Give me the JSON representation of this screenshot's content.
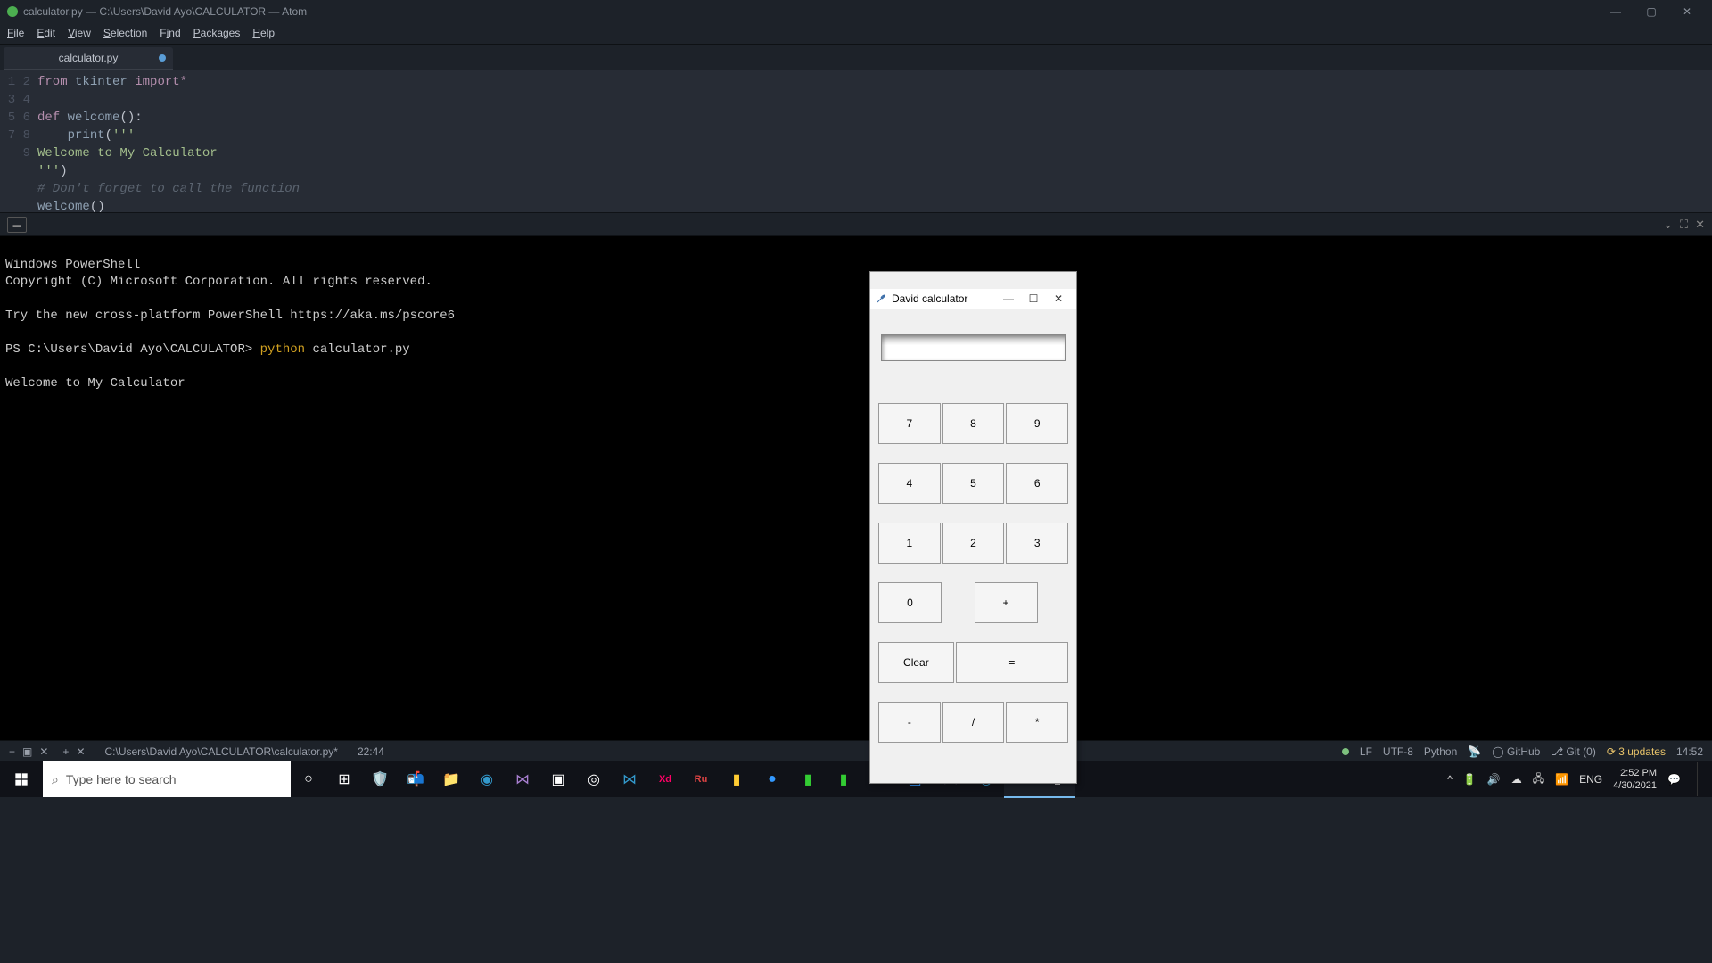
{
  "window": {
    "title": "calculator.py — C:\\Users\\David Ayo\\CALCULATOR — Atom"
  },
  "menu": [
    "File",
    "Edit",
    "View",
    "Selection",
    "Find",
    "Packages",
    "Help"
  ],
  "tab": {
    "name": "calculator.py",
    "modified": true
  },
  "code": {
    "lines": [
      "1",
      "2",
      "3",
      "4",
      "5",
      "6",
      "7",
      "8",
      "9"
    ],
    "l1_kw": "from",
    "l1_mod": "tkinter",
    "l1_kw2": "import",
    "l1_star": "*",
    "l3_kw": "def",
    "l3_fn": "welcome",
    "l3_rest": "():",
    "l4_indent": "    ",
    "l4_fn": "print",
    "l4_open": "(",
    "l4_str": "'''",
    "l5": "Welcome to My Calculator",
    "l6": "''')",
    "l7": "# Don't forget to call the function",
    "l8_fn": "welcome",
    "l8_rest": "()"
  },
  "terminal": {
    "line1": "Windows PowerShell",
    "line2": "Copyright (C) Microsoft Corporation. All rights reserved.",
    "line3": "Try the new cross-platform PowerShell https://aka.ms/pscore6",
    "prompt": "PS C:\\Users\\David Ayo\\CALCULATOR> ",
    "cmd": "python",
    "arg": " calculator.py",
    "out": "Welcome to My Calculator"
  },
  "calc": {
    "title": "David calculator",
    "b7": "7",
    "b8": "8",
    "b9": "9",
    "b4": "4",
    "b5": "5",
    "b6": "6",
    "b1": "1",
    "b2": "2",
    "b3": "3",
    "b0": "0",
    "bplus": "+",
    "bclear": "Clear",
    "beq": "=",
    "bmin": "-",
    "bdiv": "/",
    "bmul": "*"
  },
  "status": {
    "path": "C:\\Users\\David Ayo\\CALCULATOR\\calculator.py*",
    "pos": "22:44",
    "eol": "LF",
    "enc": "UTF-8",
    "lang": "Python",
    "github": "GitHub",
    "git": "Git (0)",
    "upd": "3 updates",
    "time": "14:52"
  },
  "taskbar": {
    "search_placeholder": "Type here to search",
    "clock_time": "2:52 PM",
    "clock_date": "4/30/2021"
  }
}
